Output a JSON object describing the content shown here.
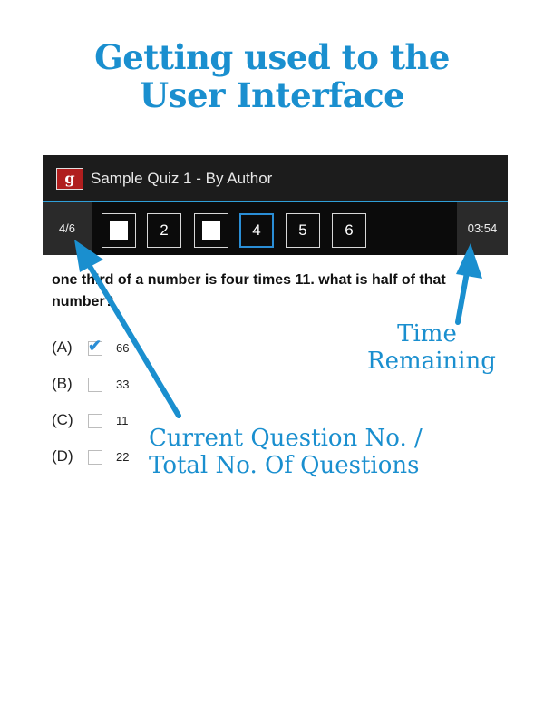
{
  "headline": {
    "line1": "Getting used to the",
    "line2": "User Interface"
  },
  "app": {
    "icon_letter": "g",
    "title": "Sample Quiz 1 - By Author",
    "counter": "4/6",
    "timer": "03:54",
    "question_buttons": [
      {
        "label": "",
        "state": "answered"
      },
      {
        "label": "2",
        "state": "unanswered"
      },
      {
        "label": "",
        "state": "answered"
      },
      {
        "label": "4",
        "state": "current"
      },
      {
        "label": "5",
        "state": "unanswered"
      },
      {
        "label": "6",
        "state": "unanswered"
      }
    ],
    "question_text": "one third of a number is four times 11. what is half of that number?",
    "options": [
      {
        "letter": "(A)",
        "value": "66",
        "checked": true
      },
      {
        "letter": "(B)",
        "value": "33",
        "checked": false
      },
      {
        "letter": "(C)",
        "value": "11",
        "checked": false
      },
      {
        "letter": "(D)",
        "value": "22",
        "checked": false
      }
    ]
  },
  "annotations": {
    "time_line1": "Time",
    "time_line2": "Remaining",
    "current_line1": "Current Question No. /",
    "current_line2": "Total No. Of Questions"
  },
  "colors": {
    "annotation_blue": "#1a8fcf",
    "actionbar_bg": "#1c1c1c",
    "accent_line": "#2f9fd8",
    "icon_red": "#b01e1e"
  }
}
